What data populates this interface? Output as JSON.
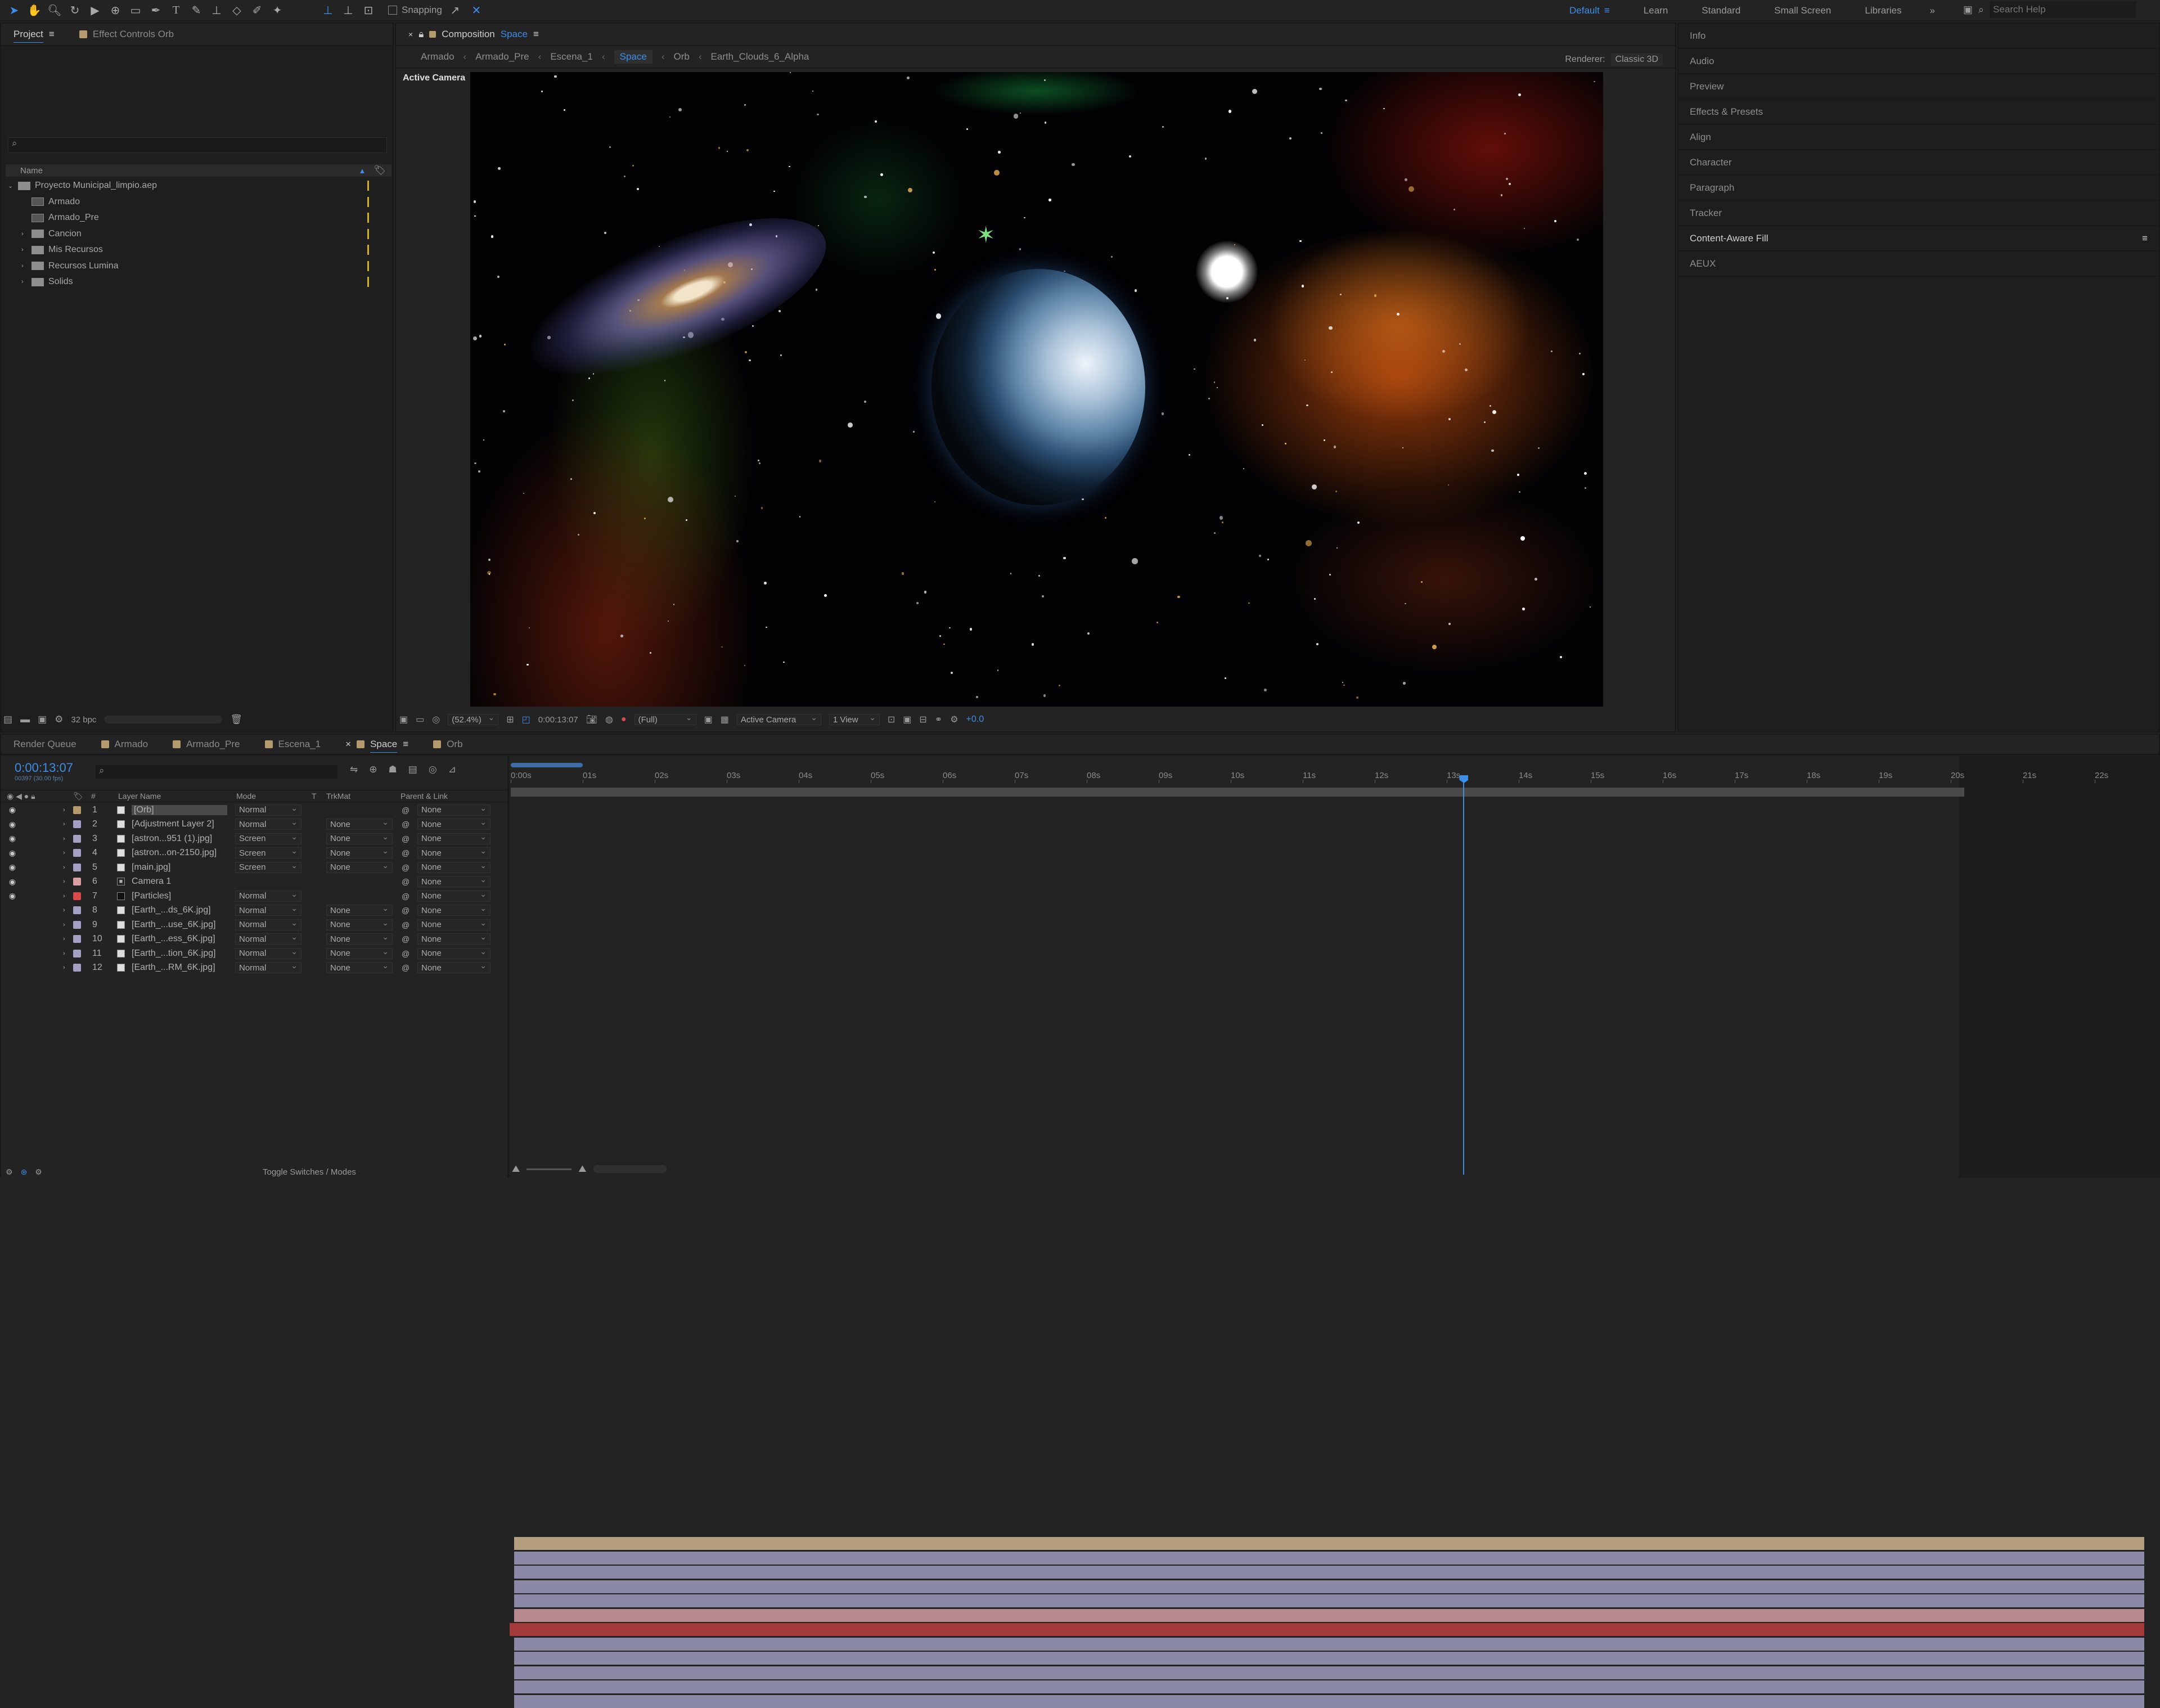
{
  "toolbar": {
    "snapping_label": "Snapping",
    "workspaces": [
      "Default",
      "Learn",
      "Standard",
      "Small Screen",
      "Libraries"
    ],
    "active_workspace": "Default",
    "search_placeholder": "Search Help"
  },
  "project_panel": {
    "tabs": [
      "Project",
      "Effect Controls Orb"
    ],
    "column_name": "Name",
    "items": [
      {
        "label": "Proyecto Municipal_limpio.aep",
        "type": "folder-open",
        "indent": 0
      },
      {
        "label": "Armado",
        "type": "composition",
        "indent": 1
      },
      {
        "label": "Armado_Pre",
        "type": "composition",
        "indent": 1
      },
      {
        "label": "Cancion",
        "type": "folder",
        "indent": 1
      },
      {
        "label": "Mis Recursos",
        "type": "folder",
        "indent": 1
      },
      {
        "label": "Recursos Lumina",
        "type": "folder",
        "indent": 1
      },
      {
        "label": "Solids",
        "type": "folder",
        "indent": 1
      }
    ],
    "bpc": "32 bpc"
  },
  "composition_panel": {
    "header_label": "Composition",
    "header_comp": "Space",
    "breadcrumbs": [
      "Armado",
      "Armado_Pre",
      "Escena_1",
      "Space",
      "Orb",
      "Earth_Clouds_6_Alpha"
    ],
    "active_breadcrumb": "Space",
    "renderer_label": "Renderer:",
    "renderer_value": "Classic 3D",
    "active_camera_label": "Active Camera",
    "zoom": "(52.4%)",
    "timecode": "0:00:13:07",
    "resolution": "(Full)",
    "view_camera": "Active Camera",
    "view_count": "1 View",
    "exposure": "+0.0"
  },
  "right_panels": [
    "Info",
    "Audio",
    "Preview",
    "Effects & Presets",
    "Align",
    "Character",
    "Paragraph",
    "Tracker",
    "Content-Aware Fill",
    "AEUX"
  ],
  "timeline": {
    "tabs": [
      {
        "label": "Render Queue",
        "color": ""
      },
      {
        "label": "Armado",
        "color": "#b59a6e"
      },
      {
        "label": "Armado_Pre",
        "color": "#b59a6e"
      },
      {
        "label": "Escena_1",
        "color": "#b59a6e"
      },
      {
        "label": "Space",
        "color": "#b59a6e"
      },
      {
        "label": "Orb",
        "color": "#b59a6e"
      }
    ],
    "active_tab": "Space",
    "current_time": "0:00:13:07",
    "frame_info": "00397 (30.00 fps)",
    "columns": {
      "num": "#",
      "layer_name": "Layer Name",
      "mode": "Mode",
      "t": "T",
      "trkmat": "TrkMat",
      "parent": "Parent & Link"
    },
    "ruler": [
      "0:00s",
      "01s",
      "02s",
      "03s",
      "04s",
      "05s",
      "06s",
      "07s",
      "08s",
      "09s",
      "10s",
      "11s",
      "12s",
      "13s",
      "14s",
      "15s",
      "16s",
      "17s",
      "18s",
      "19s",
      "20s",
      "21s",
      "22s"
    ],
    "playhead_seconds": 13.23,
    "layers": [
      {
        "num": "1",
        "name": "[Orb]",
        "mode": "Normal",
        "trkmat": "",
        "parent": "None",
        "label_color": "#b59a6e",
        "bar_color": "#b39f7d",
        "visible": true,
        "type": "comp"
      },
      {
        "num": "2",
        "name": "[Adjustment Layer 2]",
        "mode": "Normal",
        "trkmat": "None",
        "parent": "None",
        "label_color": "#a4a0c4",
        "bar_color": "#8a8aa6",
        "visible": true,
        "type": "solid"
      },
      {
        "num": "3",
        "name": "[astron...951 (1).jpg]",
        "mode": "Screen",
        "trkmat": "None",
        "parent": "None",
        "label_color": "#a4a0c4",
        "bar_color": "#8a8aa6",
        "visible": true,
        "type": "image"
      },
      {
        "num": "4",
        "name": "[astron...on-2150.jpg]",
        "mode": "Screen",
        "trkmat": "None",
        "parent": "None",
        "label_color": "#a4a0c4",
        "bar_color": "#8a8aa6",
        "visible": true,
        "type": "image"
      },
      {
        "num": "5",
        "name": "[main.jpg]",
        "mode": "Screen",
        "trkmat": "None",
        "parent": "None",
        "label_color": "#a4a0c4",
        "bar_color": "#8a8aa6",
        "visible": true,
        "type": "image"
      },
      {
        "num": "6",
        "name": "Camera 1",
        "mode": "",
        "trkmat": "",
        "parent": "None",
        "label_color": "#d9a0a6",
        "bar_color": "#b88a90",
        "visible": true,
        "type": "camera"
      },
      {
        "num": "7",
        "name": "[Particles]",
        "mode": "Normal",
        "trkmat": "",
        "parent": "None",
        "label_color": "#d94a4a",
        "bar_color": "#a53a3a",
        "visible": true,
        "type": "solid-black"
      },
      {
        "num": "8",
        "name": "[Earth_...ds_6K.jpg]",
        "mode": "Normal",
        "trkmat": "None",
        "parent": "None",
        "label_color": "#a4a0c4",
        "bar_color": "#8a8aa6",
        "visible": false,
        "type": "image"
      },
      {
        "num": "9",
        "name": "[Earth_...use_6K.jpg]",
        "mode": "Normal",
        "trkmat": "None",
        "parent": "None",
        "label_color": "#a4a0c4",
        "bar_color": "#8a8aa6",
        "visible": false,
        "type": "image"
      },
      {
        "num": "10",
        "name": "[Earth_...ess_6K.jpg]",
        "mode": "Normal",
        "trkmat": "None",
        "parent": "None",
        "label_color": "#a4a0c4",
        "bar_color": "#8a8aa6",
        "visible": false,
        "type": "image"
      },
      {
        "num": "11",
        "name": "[Earth_...tion_6K.jpg]",
        "mode": "Normal",
        "trkmat": "None",
        "parent": "None",
        "label_color": "#a4a0c4",
        "bar_color": "#8a8aa6",
        "visible": false,
        "type": "image"
      },
      {
        "num": "12",
        "name": "[Earth_...RM_6K.jpg]",
        "mode": "Normal",
        "trkmat": "None",
        "parent": "None",
        "label_color": "#a4a0c4",
        "bar_color": "#8a8aa6",
        "visible": false,
        "type": "image"
      }
    ],
    "toggle_label": "Toggle Switches / Modes"
  },
  "colors": {
    "accent": "#3d8ee8",
    "panel_bg": "#1e1e1e",
    "chrome_bg": "#232323"
  }
}
